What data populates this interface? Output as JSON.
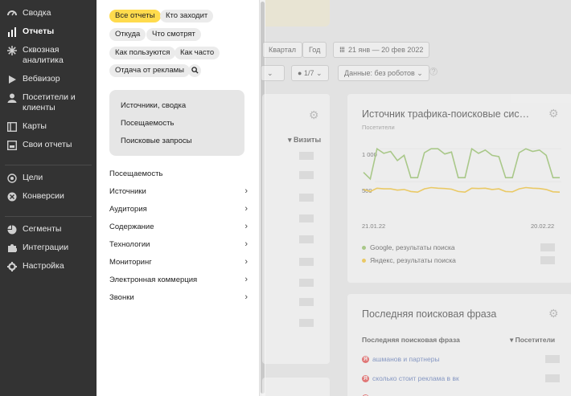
{
  "sidebar": {
    "items": [
      {
        "label": "Сводка",
        "icon": "dashboard-icon",
        "active": false
      },
      {
        "label": "Отчеты",
        "icon": "bar-chart-icon",
        "active": true
      },
      {
        "label": "Сквозная аналитика",
        "icon": "asterisk-icon",
        "active": false
      },
      {
        "label": "Вебвизор",
        "icon": "play-icon",
        "active": false
      },
      {
        "label": "Посетители и клиенты",
        "icon": "person-icon",
        "active": false
      },
      {
        "label": "Карты",
        "icon": "map-icon",
        "active": false
      },
      {
        "label": "Свои отчеты",
        "icon": "report-icon",
        "active": false
      },
      {
        "label": "Цели",
        "icon": "target-icon",
        "active": false
      },
      {
        "label": "Конверсии",
        "icon": "conversion-icon",
        "active": false
      },
      {
        "label": "Сегменты",
        "icon": "pie-icon",
        "active": false
      },
      {
        "label": "Интеграции",
        "icon": "puzzle-icon",
        "active": false
      },
      {
        "label": "Настройка",
        "icon": "gear-icon",
        "active": false
      }
    ]
  },
  "panel": {
    "chips": [
      "Все отчеты",
      "Кто заходит",
      "Откуда",
      "Что смотрят",
      "Как пользуются",
      "Как часто",
      "Отдача от рекламы"
    ],
    "quick": [
      "Источники, сводка",
      "Посещаемость",
      "Поисковые запросы"
    ],
    "menu": [
      {
        "label": "Посещаемость",
        "has_children": false
      },
      {
        "label": "Источники",
        "has_children": true
      },
      {
        "label": "Аудитория",
        "has_children": true
      },
      {
        "label": "Содержание",
        "has_children": true
      },
      {
        "label": "Технологии",
        "has_children": true
      },
      {
        "label": "Мониторинг",
        "has_children": true
      },
      {
        "label": "Электронная коммерция",
        "has_children": true
      },
      {
        "label": "Звонки",
        "has_children": true
      }
    ]
  },
  "toolbar": {
    "quarter": "Квартал",
    "year": "Год",
    "date_range": "21 янв — 20 фев 2022",
    "sampling": "1/7",
    "robots": "Данные: без роботов"
  },
  "left_card": {
    "column": "▾ Визиты"
  },
  "traffic_card": {
    "title": "Источник трафика-поисковые сис…",
    "subtitle": "Посетители",
    "y_ticks": [
      "1 000",
      "500"
    ],
    "x_start": "21.01.22",
    "x_end": "20.02.22",
    "legend": [
      "Google, результаты поиска",
      "Яндекс, результаты поиска"
    ],
    "colors": {
      "google": "#7cb342",
      "yandex": "#f2b600"
    }
  },
  "phrase_card": {
    "title": "Последняя поисковая фраза",
    "col_phrase": "Последняя поисковая фраза",
    "col_visitors": "▾ Посетители",
    "rows": [
      "ашманов и партнеры",
      "сколько стоит реклама в вк"
    ]
  },
  "chart_data": {
    "type": "line",
    "title": "Источник трафика-поисковые сис…",
    "ylabel": "Посетители",
    "ylim": [
      0,
      1100
    ],
    "x_start": "21.01.22",
    "x_end": "20.02.22",
    "series": [
      {
        "name": "Google, результаты поиска",
        "values": [
          640,
          540,
          1000,
          930,
          960,
          820,
          900,
          560,
          560,
          940,
          1000,
          1000,
          920,
          950,
          560,
          560,
          1000,
          930,
          980,
          900,
          880,
          560,
          560,
          940,
          1000,
          960,
          980,
          900,
          560,
          560
        ]
      },
      {
        "name": "Яндекс, результаты поиска",
        "values": [
          380,
          350,
          400,
          390,
          390,
          370,
          380,
          350,
          340,
          390,
          410,
          400,
          395,
          385,
          350,
          340,
          400,
          395,
          400,
          380,
          390,
          350,
          345,
          390,
          410,
          400,
          395,
          380,
          345,
          340
        ]
      }
    ]
  }
}
